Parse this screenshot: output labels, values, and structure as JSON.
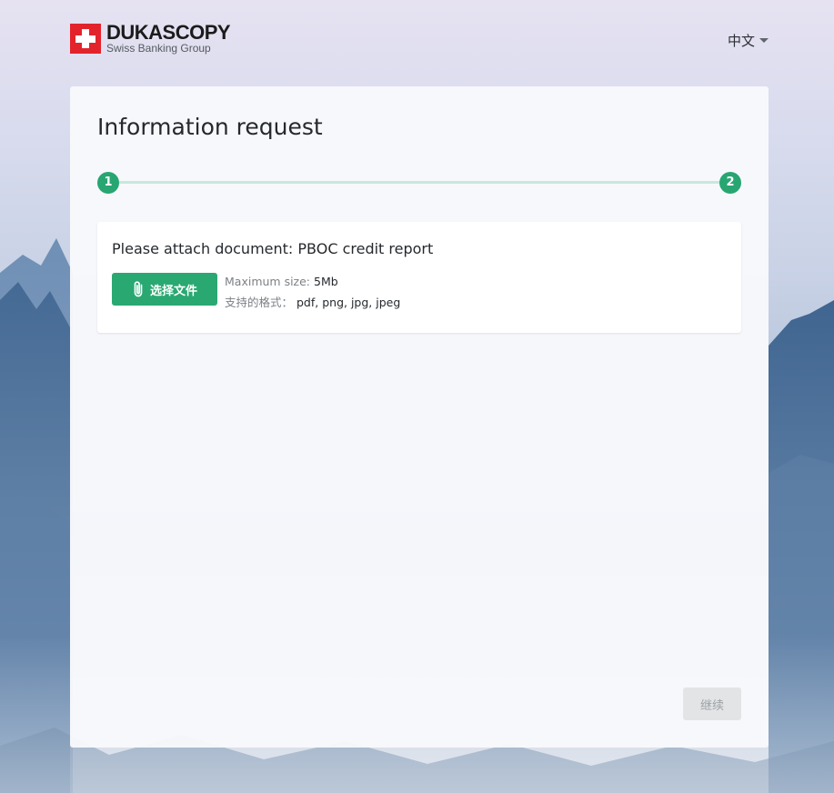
{
  "header": {
    "logo_name": "DUKASCOPY",
    "logo_tagline": "Swiss Banking Group",
    "language": "中文"
  },
  "form": {
    "title": "Information request",
    "steps": [
      "1",
      "2"
    ],
    "current_step": 1,
    "attach_title": "Please attach document: PBOC credit report",
    "choose_file_label": "选择文件",
    "max_size_label": "Maximum size:",
    "max_size_value": "5Mb",
    "formats_label": "支持的格式：",
    "formats_value": "pdf, png, jpg, jpeg",
    "continue_label": "继续"
  },
  "colors": {
    "accent": "#27a672",
    "accent_light": "#c6e9da",
    "brand_red": "#e3232b",
    "disabled_button": "#e2e4e6"
  },
  "icons": {
    "attach": "paperclip-icon",
    "language_dropdown": "chevron-down-icon"
  }
}
